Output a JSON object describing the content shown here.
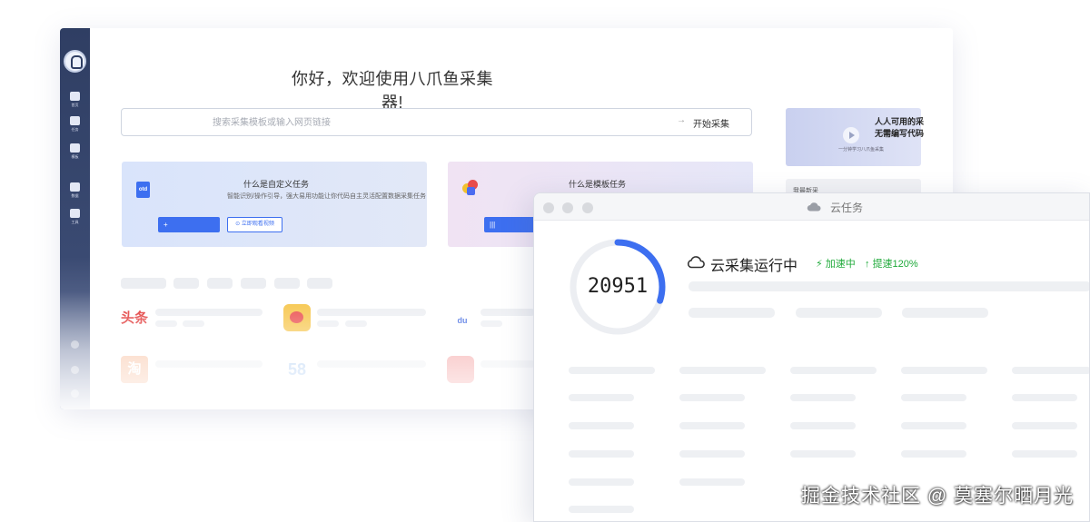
{
  "app": {
    "greeting": "你好，欢迎使用八爪鱼采集器!",
    "sidebar": {
      "items": [
        {
          "icon": "play-icon",
          "label": "首页"
        },
        {
          "icon": "bookmark-icon",
          "label": "任务"
        },
        {
          "icon": "pinwheel-icon",
          "label": "模板"
        },
        {
          "icon": "heart-icon",
          "label": "数据"
        },
        {
          "icon": "briefcase-icon",
          "label": "工具"
        }
      ]
    },
    "search": {
      "placeholder": "搜索采集模板或输入网页链接",
      "start_label": "开始采集",
      "arrow": "→"
    },
    "cards": {
      "custom": {
        "icon_text": "otd",
        "title": "什么是自定义任务",
        "desc": "智能识别/操作引导，强大易用功能让你代码自主灵活配置数据采集任务",
        "primary_label": "+",
        "outline_label": "⊙ 立即观看视频"
      },
      "template": {
        "title": "什么是模板任务",
        "primary_label": "|||"
      }
    },
    "promo": {
      "title_line1": "人人可用的采",
      "title_line2": "无需编写代码",
      "subtitle": "一分钟学习八爪鱼采集"
    },
    "my_tasks_label": "我最新采",
    "site_icons": [
      {
        "name": "toutiao",
        "text": "头条"
      },
      {
        "name": "weibo",
        "text": ""
      },
      {
        "name": "baidu",
        "text": "du"
      },
      {
        "name": "taobao",
        "text": "淘"
      },
      {
        "name": "58",
        "text": "58"
      },
      {
        "name": "red-app",
        "text": ""
      }
    ]
  },
  "cloud_task": {
    "window_title": "云任务",
    "progress_value": 20951,
    "progress_fraction": 0.3,
    "status": "云采集运行中",
    "tag_accelerating": "加速中",
    "tag_speedup": "提速120%",
    "accent_color": "#3d6ff0",
    "tag_color": "#1faa3a"
  },
  "watermark": "掘金技术社区 @ 莫塞尔晒月光"
}
